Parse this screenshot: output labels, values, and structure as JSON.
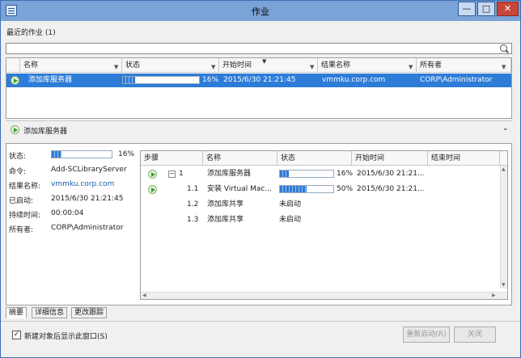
{
  "window": {
    "title": "作业",
    "min_glyph": "—",
    "max_glyph": "□",
    "close_glyph": "✕"
  },
  "recent": {
    "label": "最近的作业 (1)"
  },
  "search": {
    "placeholder": "",
    "value": ""
  },
  "jobs_grid": {
    "columns": [
      "名称",
      "状态",
      "开始时间",
      "结果名称",
      "所有者"
    ],
    "rows": [
      {
        "name": "添加库服务器",
        "status_pct": "16%",
        "progress": 0.16,
        "start": "2015/6/30 21:21:45",
        "result": "vmmku.corp.com",
        "owner": "CORP\\Administrator"
      }
    ]
  },
  "expander": {
    "label": "添加库服务器"
  },
  "summary": {
    "state_label": "状态:",
    "state_pct": "16%",
    "state_progress": 0.16,
    "command_label": "命令:",
    "command": "Add-SCLibraryServer",
    "result_label": "结果名称:",
    "result": "vmmku.corp.com",
    "started_label": "已启动:",
    "started": "2015/6/30 21:21:45",
    "duration_label": "持续时间:",
    "duration": "00:00:04",
    "owner_label": "所有者:",
    "owner": "CORP\\Administrator"
  },
  "steps_grid": {
    "columns": [
      "步骤",
      "名称",
      "状态",
      "开始时间",
      "结束时间"
    ],
    "rows": [
      {
        "step": "1",
        "name": "添加库服务器",
        "status_pct": "16%",
        "progress": 0.16,
        "start": "2015/6/30 21:21...",
        "end": ""
      },
      {
        "step": "1.1",
        "name": "安装 Virtual Mac...",
        "status_pct": "50%",
        "progress": 0.5,
        "start": "2015/6/30 21:21...",
        "end": ""
      },
      {
        "step": "1.2",
        "name": "添加库共享",
        "status_text": "未启动",
        "start": "",
        "end": ""
      },
      {
        "step": "1.3",
        "name": "添加库共享",
        "status_text": "未启动",
        "start": "",
        "end": ""
      }
    ]
  },
  "tabs": [
    "摘要",
    "详细信息",
    "更改跟踪"
  ],
  "footer": {
    "checkbox_label": "新建对象后显示此窗口(S)",
    "checked": true,
    "restart_label": "重新启动(R)",
    "close_label": "关闭"
  },
  "colors": {
    "accent": "#2d7cd7",
    "title_bar": "#7aa3d8",
    "progress": "#2f7ad6"
  }
}
